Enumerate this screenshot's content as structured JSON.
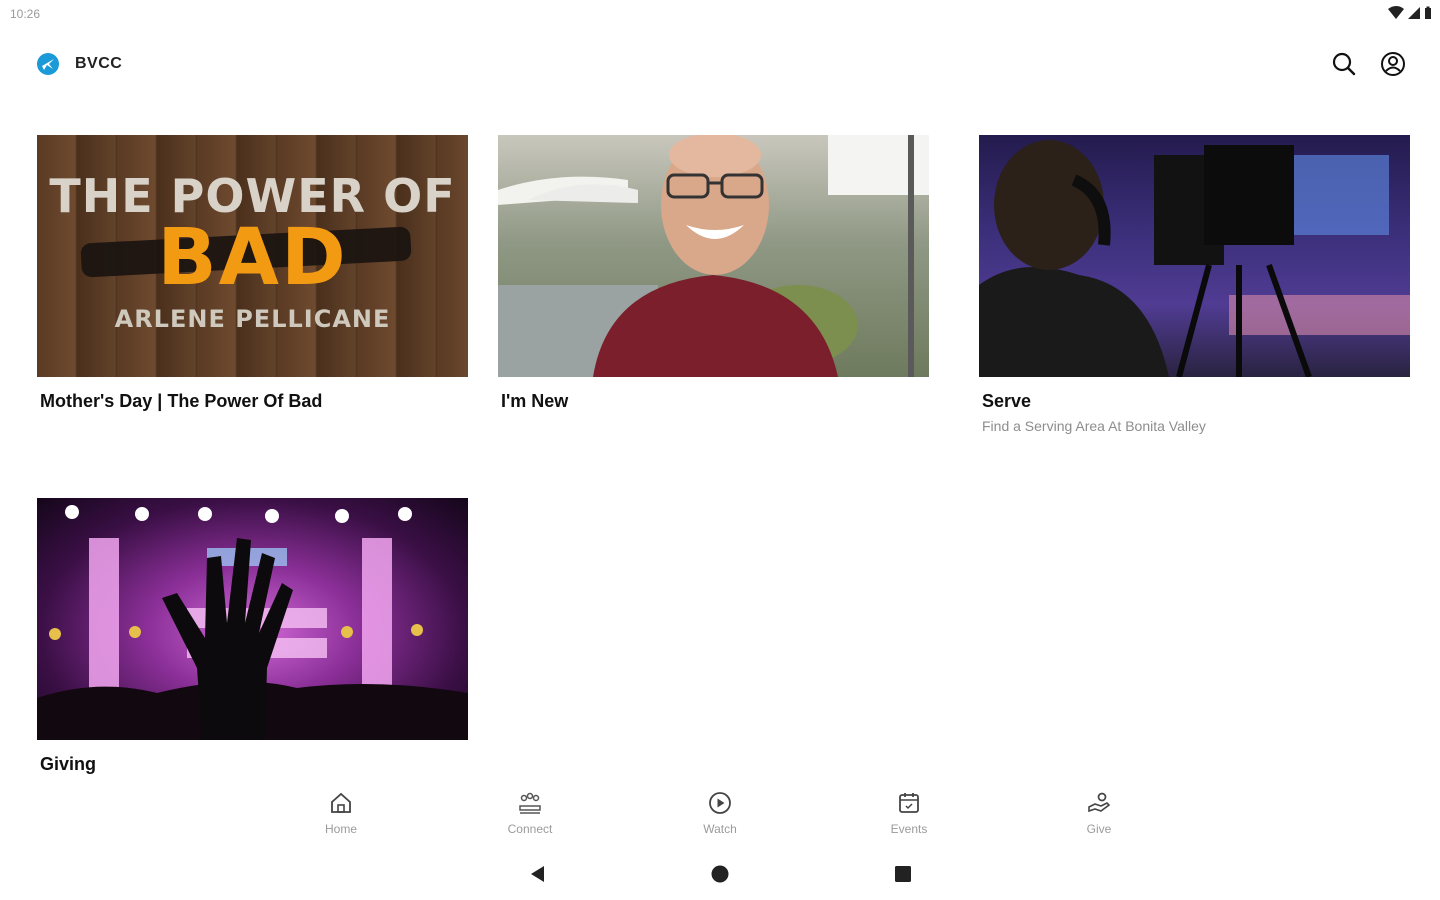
{
  "status_bar": {
    "time": "10:26"
  },
  "app_bar": {
    "title": "BVCC"
  },
  "cards": [
    {
      "title": "Mother's Day | The Power Of Bad",
      "subtitle": "",
      "thumb_text": {
        "line1": "THE POWER OF",
        "line2": "BAD",
        "line3": "ARLENE PELLICANE"
      }
    },
    {
      "title": "I'm New",
      "subtitle": ""
    },
    {
      "title": "Serve",
      "subtitle": "Find a Serving Area At Bonita Valley"
    },
    {
      "title": "Giving",
      "subtitle": ""
    }
  ],
  "bottom_nav": {
    "items": [
      {
        "label": "Home",
        "icon": "home-icon"
      },
      {
        "label": "Connect",
        "icon": "connect-icon"
      },
      {
        "label": "Watch",
        "icon": "play-circle-icon"
      },
      {
        "label": "Events",
        "icon": "calendar-icon"
      },
      {
        "label": "Give",
        "icon": "give-icon"
      }
    ]
  }
}
